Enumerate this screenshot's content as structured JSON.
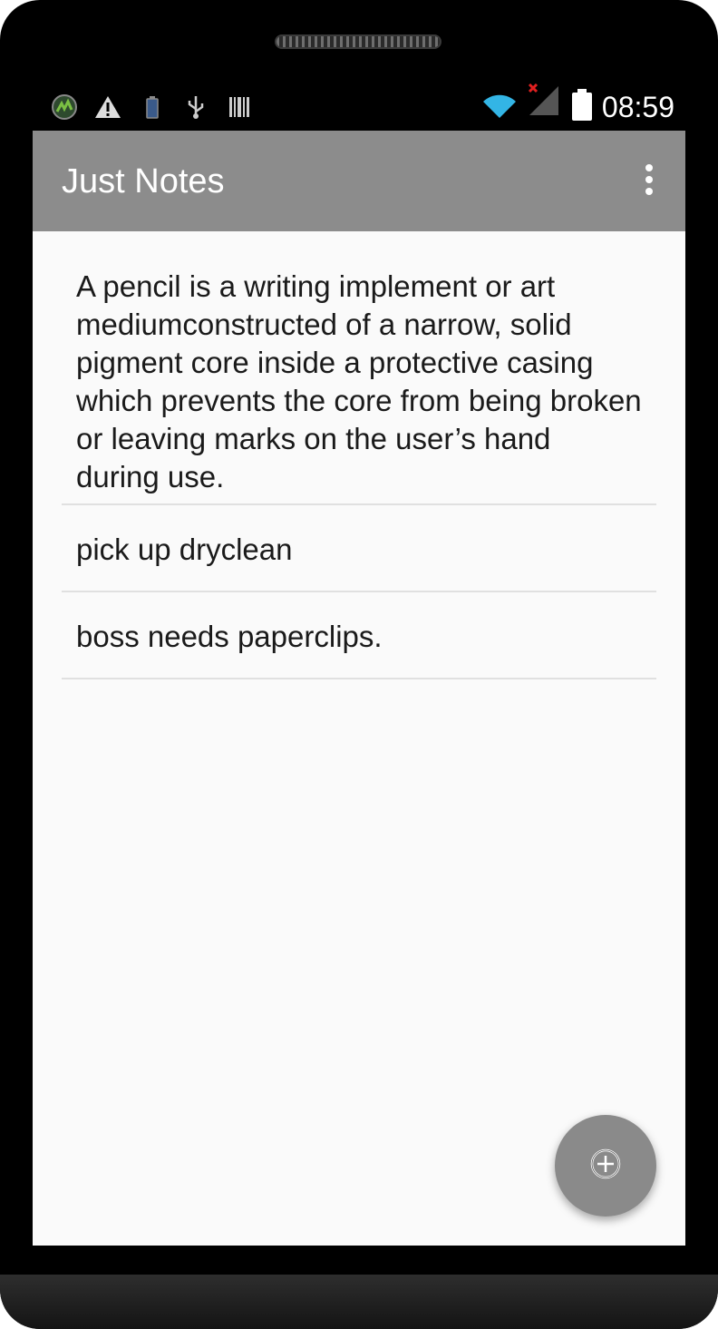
{
  "status_bar": {
    "time": "08:59",
    "left_icons": [
      "app-logo-icon",
      "warning-icon",
      "battery-small-icon",
      "usb-icon",
      "barcode-icon"
    ],
    "right_icons": [
      "wifi-icon",
      "signal-no-service-icon",
      "battery-icon"
    ]
  },
  "app_bar": {
    "title": "Just Notes",
    "menu_icon": "overflow-menu-icon"
  },
  "notes": [
    {
      "text": "A pencil is a writing implement or art mediumconstructed of a narrow, solid pigment core inside a protective casing which prevents the core from being broken or leaving marks on the user’s hand during use."
    },
    {
      "text": "pick up dryclean"
    },
    {
      "text": "boss needs paperclips."
    }
  ],
  "fab": {
    "icon": "add-circle-icon"
  },
  "colors": {
    "app_bar": "#8c8c8c",
    "background": "#fafafa",
    "fab": "#8a8a8a",
    "divider": "#e0e0e0"
  }
}
